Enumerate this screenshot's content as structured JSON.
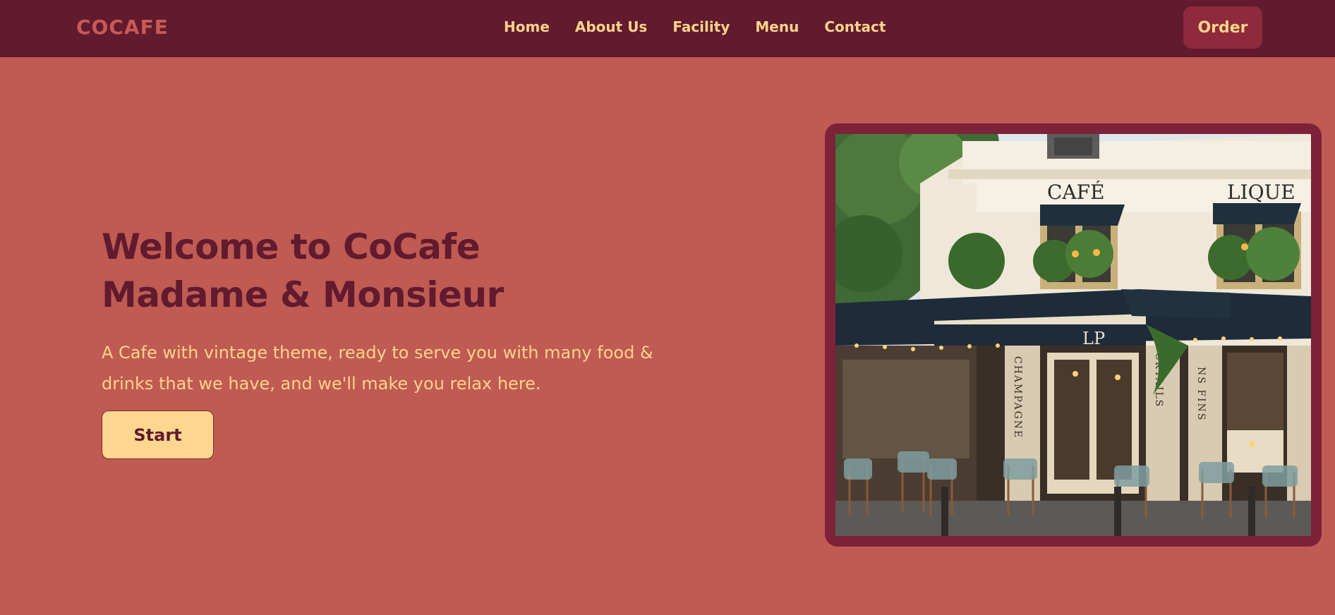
{
  "brand": {
    "logo": "COCAFE"
  },
  "nav": {
    "items": [
      {
        "label": "Home"
      },
      {
        "label": "About Us"
      },
      {
        "label": "Facility"
      },
      {
        "label": "Menu"
      },
      {
        "label": "Contact"
      }
    ],
    "order_label": "Order"
  },
  "hero": {
    "title_line1": "Welcome to CoCafe",
    "title_line2": "Madame & Monsieur",
    "description": "A Cafe with vintage theme, ready to serve you with many food & drinks that we have, and we'll make you relax here.",
    "start_label": "Start"
  },
  "photo": {
    "sign_cafe": "CAFÉ",
    "sign_lique": "LIQUE",
    "sign_lp": "LP",
    "sign_champagne": "CHAMPAGNE",
    "sign_cktails": "CKTAILS",
    "sign_nsfins": "NS FINS"
  },
  "colors": {
    "background": "#bf5b52",
    "navbar": "#611a2e",
    "accent": "#ffd38a",
    "order_button": "#8e2a3b",
    "frame": "#7d2238"
  }
}
